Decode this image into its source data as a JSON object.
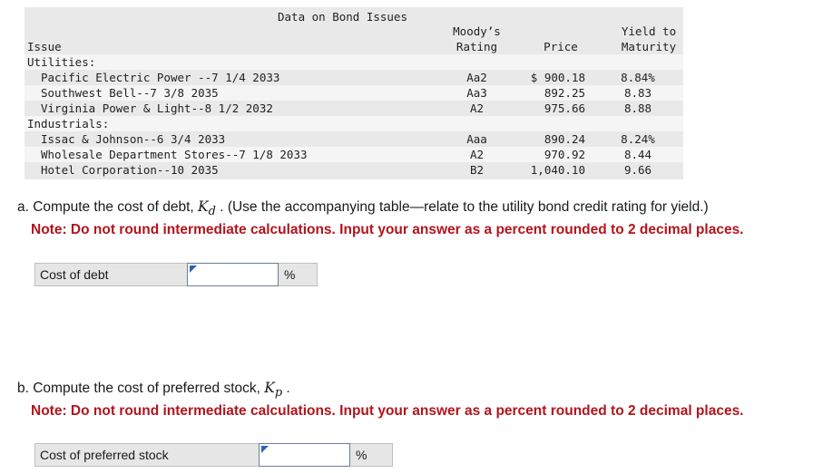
{
  "table": {
    "caption": "Data on Bond Issues",
    "headers": {
      "issue": "Issue",
      "rating_line1": "Moody’s",
      "rating_line2": "Rating",
      "price": "Price",
      "yield_line1": "Yield to",
      "yield_line2": "Maturity"
    },
    "groups": [
      {
        "name": "Utilities:",
        "rows": [
          {
            "issue": "Pacific Electric Power --7 1/4 2033",
            "rating": "Aa2",
            "price": "$ 900.18",
            "yield": "8.84%"
          },
          {
            "issue": "Southwest Bell--7 3/8 2035",
            "rating": "Aa3",
            "price": "892.25",
            "yield": "8.83"
          },
          {
            "issue": "Virginia Power & Light--8 1/2 2032",
            "rating": "A2",
            "price": "975.66",
            "yield": "8.88"
          }
        ]
      },
      {
        "name": "Industrials:",
        "rows": [
          {
            "issue": "Issac & Johnson--6 3/4 2033",
            "rating": "Aaa",
            "price": "890.24",
            "yield": "8.24%"
          },
          {
            "issue": "Wholesale Department Stores--7 1/8 2033",
            "rating": "A2",
            "price": "970.92",
            "yield": "8.44"
          },
          {
            "issue": "Hotel Corporation--10 2035",
            "rating": "B2",
            "price": "1,040.10",
            "yield": "9.66"
          }
        ]
      }
    ]
  },
  "question_a": {
    "prefix": "a. Compute the cost of debt, ",
    "symbol": "K",
    "subscript": "d",
    "suffix": " . (Use the accompanying table—relate to the utility bond credit rating for yield.)",
    "note": "Note: Do not round intermediate calculations. Input your answer as a percent rounded to 2 decimal places."
  },
  "answer_a": {
    "label": "Cost of debt",
    "value": "",
    "unit": "%"
  },
  "question_b": {
    "prefix": "b. Compute the cost of preferred stock, ",
    "symbol": "K",
    "subscript": "p",
    "suffix": " .",
    "note": "Note: Do not round intermediate calculations. Input your answer as a percent rounded to 2 decimal places."
  },
  "answer_b": {
    "label": "Cost of preferred stock",
    "value": "",
    "unit": "%"
  }
}
